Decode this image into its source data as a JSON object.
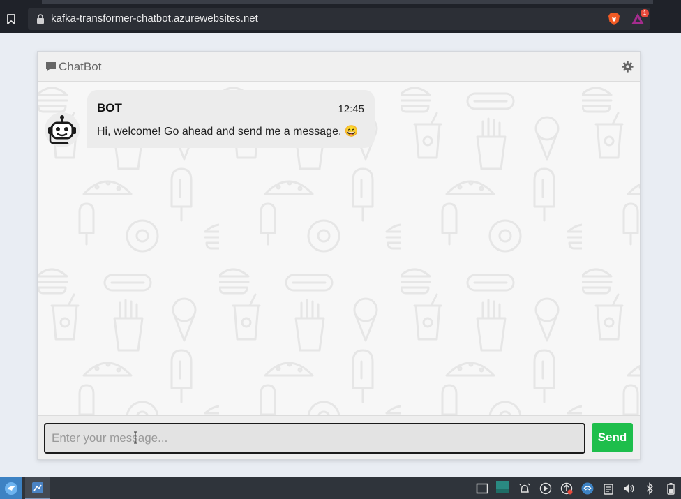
{
  "browser": {
    "url": "kafka-transformer-chatbot.azurewebsites.net",
    "rewards_badge": "1"
  },
  "chat": {
    "title": "ChatBot",
    "messages": [
      {
        "sender": "BOT",
        "time": "12:45",
        "text": "Hi, welcome! Go ahead and send me a message. 😄"
      }
    ],
    "input_placeholder": "Enter your message...",
    "send_label": "Send"
  },
  "taskbar": {
    "tray_icons": [
      "window-icon",
      "teal-window-icon",
      "alarm-icon",
      "play-icon",
      "update-icon",
      "network-icon",
      "clipboard-icon",
      "volume-icon",
      "bluetooth-icon",
      "battery-icon"
    ]
  },
  "colors": {
    "send_button": "#1ebe4b",
    "header_bg": "#f0f0f0",
    "browser_chrome": "#1f2229",
    "taskbar": "#2f343b"
  }
}
